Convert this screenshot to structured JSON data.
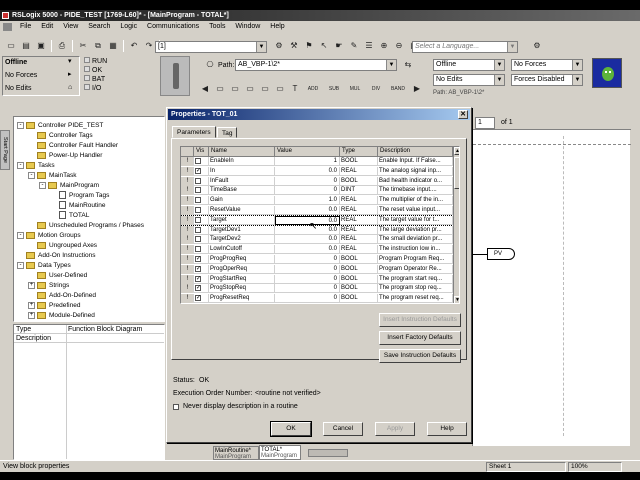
{
  "window": {
    "title": "RSLogix 5000 - PIDE_TEST [1769-L60]* - [MainProgram - TOTAL*]"
  },
  "menu": [
    "File",
    "Edit",
    "View",
    "Search",
    "Logic",
    "Communications",
    "Tools",
    "Window",
    "Help"
  ],
  "toolbar": {
    "routine_combo": "[1]",
    "language_placeholder": "Select a Language..."
  },
  "controller_status": {
    "mode": "Offline",
    "forces": "No Forces",
    "edits": "No Edits",
    "leds": [
      "RUN",
      "OK",
      "BAT",
      "I/O"
    ]
  },
  "path": {
    "label": "Path:",
    "value": "AB_VBP-1\\2*"
  },
  "instr_tabs": [
    "ADD",
    "SUB",
    "MUL",
    "DIV",
    "BAND"
  ],
  "right_status": {
    "mode": "Offline",
    "forces": "No Forces",
    "edits": "No Edits",
    "forces_state": "Forces Disabled",
    "path_text": "Path: AB_VBP-1\\2*"
  },
  "side_tab": "Start Page",
  "tree": [
    {
      "label": "Controller PIDE_TEST",
      "level": 0,
      "icon": "folder",
      "pm": "-"
    },
    {
      "label": "Controller Tags",
      "level": 1,
      "icon": "folder",
      "pm": ""
    },
    {
      "label": "Controller Fault Handler",
      "level": 1,
      "icon": "folder",
      "pm": ""
    },
    {
      "label": "Power-Up Handler",
      "level": 1,
      "icon": "folder",
      "pm": ""
    },
    {
      "label": "Tasks",
      "level": 0,
      "icon": "folder",
      "pm": "-"
    },
    {
      "label": "MainTask",
      "level": 1,
      "icon": "folder",
      "pm": "-"
    },
    {
      "label": "MainProgram",
      "level": 2,
      "icon": "folder",
      "pm": "-"
    },
    {
      "label": "Program Tags",
      "level": 3,
      "icon": "doc",
      "pm": ""
    },
    {
      "label": "MainRoutine",
      "level": 3,
      "icon": "doc",
      "pm": ""
    },
    {
      "label": "TOTAL",
      "level": 3,
      "icon": "doc",
      "pm": ""
    },
    {
      "label": "Unscheduled Programs / Phases",
      "level": 1,
      "icon": "folder",
      "pm": ""
    },
    {
      "label": "Motion Groups",
      "level": 0,
      "icon": "folder",
      "pm": "-"
    },
    {
      "label": "Ungrouped Axes",
      "level": 1,
      "icon": "folder",
      "pm": ""
    },
    {
      "label": "Add-On Instructions",
      "level": 0,
      "icon": "folder",
      "pm": ""
    },
    {
      "label": "Data Types",
      "level": 0,
      "icon": "folder",
      "pm": "-"
    },
    {
      "label": "User-Defined",
      "level": 1,
      "icon": "folder",
      "pm": ""
    },
    {
      "label": "Strings",
      "level": 1,
      "icon": "folder",
      "pm": "+"
    },
    {
      "label": "Add-On-Defined",
      "level": 1,
      "icon": "folder",
      "pm": ""
    },
    {
      "label": "Predefined",
      "level": 1,
      "icon": "folder",
      "pm": "+"
    },
    {
      "label": "Module-Defined",
      "level": 1,
      "icon": "folder",
      "pm": "+"
    }
  ],
  "props_pane": {
    "rows": [
      {
        "k": "Type",
        "v": "Function Block Diagram"
      },
      {
        "k": "Description",
        "v": ""
      }
    ]
  },
  "dialog": {
    "title": "Properties - TOT_01",
    "tabs": [
      "Parameters",
      "Tag"
    ],
    "columns": [
      "Vis",
      "Name",
      "Value",
      "Type",
      "Description"
    ],
    "rows": [
      {
        "vis": false,
        "name": "EnableIn",
        "value": "1",
        "type": "BOOL",
        "desc": "Enable Input. If False..."
      },
      {
        "vis": true,
        "name": "In",
        "value": "0.0",
        "type": "REAL",
        "desc": "The analog signal inp..."
      },
      {
        "vis": false,
        "name": "InFault",
        "value": "0",
        "type": "BOOL",
        "desc": "Bad health indicator o..."
      },
      {
        "vis": false,
        "name": "TimeBase",
        "value": "0",
        "type": "DINT",
        "desc": "The timebase input...."
      },
      {
        "vis": false,
        "name": "Gain",
        "value": "1.0",
        "type": "REAL",
        "desc": "The multiplier of the in..."
      },
      {
        "vis": false,
        "name": "ResetValue",
        "value": "0.0",
        "type": "REAL",
        "desc": "The reset value input..."
      },
      {
        "vis": false,
        "name": "Target",
        "value": "0.0",
        "type": "REAL",
        "desc": "The target value for t..."
      },
      {
        "vis": false,
        "name": "TargetDev1",
        "value": "0.0",
        "type": "REAL",
        "desc": "The large deviation pr..."
      },
      {
        "vis": false,
        "name": "TargetDev2",
        "value": "0.0",
        "type": "REAL",
        "desc": "The small deviation pr..."
      },
      {
        "vis": false,
        "name": "LowInCutoff",
        "value": "0.0",
        "type": "REAL",
        "desc": "The instruction low in..."
      },
      {
        "vis": true,
        "name": "ProgProgReq",
        "value": "0",
        "type": "BOOL",
        "desc": "Program Program Req..."
      },
      {
        "vis": true,
        "name": "ProgOperReq",
        "value": "0",
        "type": "BOOL",
        "desc": "Program Operator Re..."
      },
      {
        "vis": true,
        "name": "ProgStartReq",
        "value": "0",
        "type": "BOOL",
        "desc": "The program start req..."
      },
      {
        "vis": true,
        "name": "ProgStopReq",
        "value": "0",
        "type": "BOOL",
        "desc": "The program stop req..."
      },
      {
        "vis": true,
        "name": "ProgResetReq",
        "value": "0",
        "type": "BOOL",
        "desc": "The program reset req..."
      }
    ],
    "buttons": {
      "insert_defaults": "Insert Instruction Defaults",
      "insert_factory": "Insert Factory Defaults",
      "save_defaults": "Save Instruction Defaults"
    },
    "status": {
      "label": "Status:",
      "value": "OK"
    },
    "order": {
      "label": "Execution Order Number:",
      "value": "<routine not verified>"
    },
    "never_display": "Never display description in a routine",
    "ok": "OK",
    "cancel": "Cancel",
    "apply": "Apply",
    "help": "Help"
  },
  "sheet": {
    "page_of": "of 1",
    "page": "1",
    "pv_label": "PV"
  },
  "bottom_tabs": [
    {
      "label": "MainRoutine*",
      "sub": "MainProgram"
    },
    {
      "label": "TOTAL*",
      "sub": "MainProgram"
    }
  ],
  "statusbar": {
    "message": "View block properties",
    "sheet": "Sheet 1",
    "zoom": "100%"
  }
}
